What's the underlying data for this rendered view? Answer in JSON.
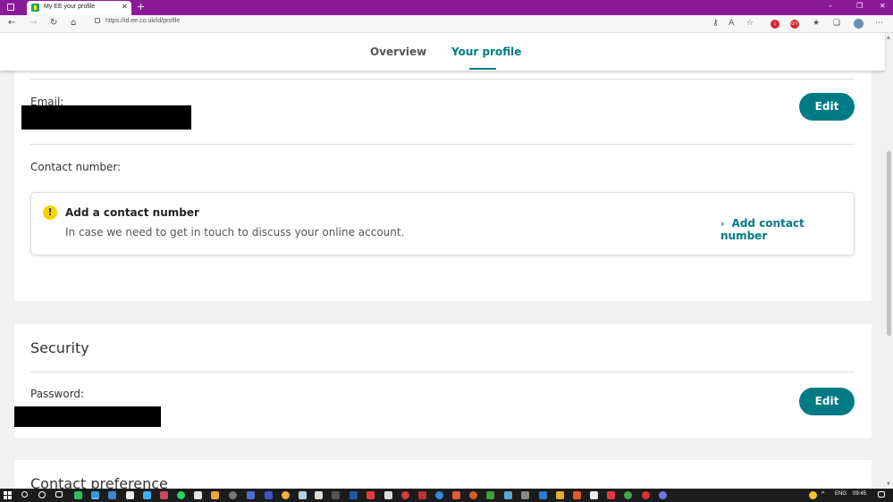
{
  "browser": {
    "tab_title": "My EE your profile",
    "url": "https://id.ee.co.uk/id/profile",
    "blocker_badge": "OFF",
    "ext_badge": "1"
  },
  "header": {
    "tabs": [
      {
        "label": "Overview"
      },
      {
        "label": "Your profile"
      }
    ]
  },
  "profile": {
    "email_label": "Email:",
    "edit_label": "Edit",
    "contact_label": "Contact number:",
    "notice_title": "Add a contact number",
    "notice_text": "In case we need to get in touch to discuss your online account.",
    "add_link": "Add contact number"
  },
  "security": {
    "title": "Security",
    "password_label": "Password:",
    "edit_label": "Edit"
  },
  "contact_pref": {
    "title": "Contact preference"
  },
  "taskbar": {
    "language": "ENG",
    "time": "09:45"
  },
  "colors": {
    "brand_teal": "#007b85",
    "browser_purple": "#8b1a99",
    "warning_yellow": "#f7d300"
  }
}
